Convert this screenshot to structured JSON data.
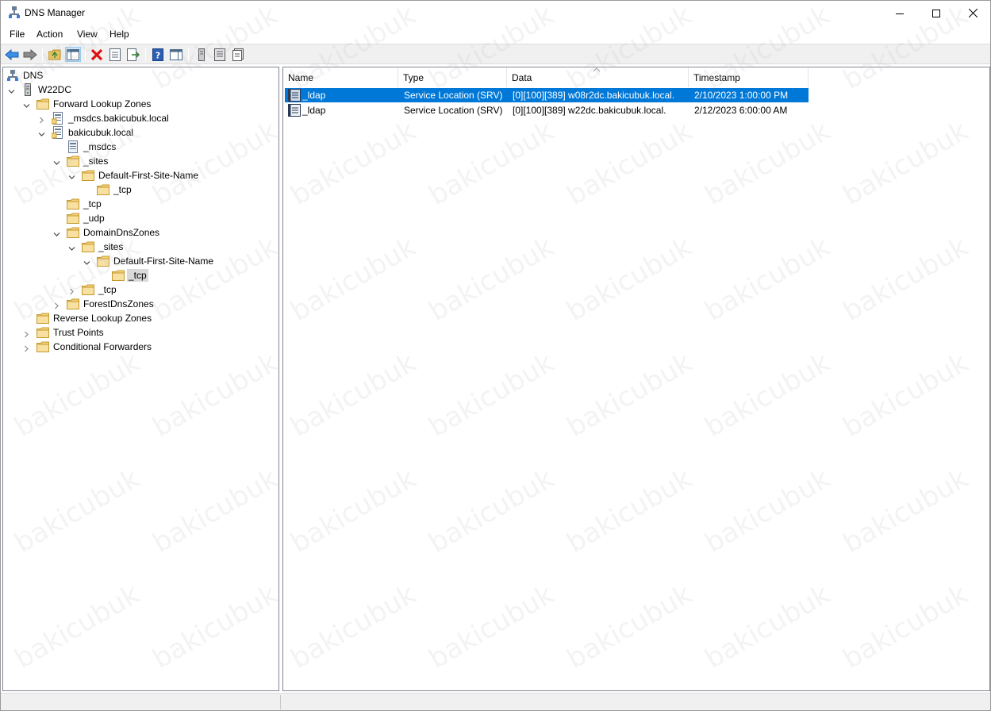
{
  "window": {
    "title": "DNS Manager",
    "controls": {
      "minimize": "minimize-icon",
      "maximize": "maximize-icon",
      "close": "close-icon"
    }
  },
  "menu": {
    "items": [
      "File",
      "Action",
      "View",
      "Help"
    ]
  },
  "toolbar": {
    "buttons": [
      "back-arrow-icon",
      "forward-arrow-icon",
      "up-folder-icon",
      "show-hide-console-tree-icon",
      "delete-icon",
      "properties-icon",
      "export-list-icon",
      "help-icon",
      "show-action-pane-icon",
      "new-host-icon",
      "new-alias-icon",
      "new-mail-exchanger-icon"
    ]
  },
  "tree": {
    "root": "DNS",
    "server": "W22DC",
    "forward_lookup_zones": "Forward Lookup Zones",
    "msdcs_zone": "_msdcs.bakicubuk.local",
    "domain_zone": "bakicubuk.local",
    "msdcs_delegation": "_msdcs",
    "sites": "_sites",
    "default_site": "Default-First-Site-Name",
    "site_tcp": "_tcp",
    "tcp": "_tcp",
    "udp": "_udp",
    "domain_dns_zones": "DomainDnsZones",
    "dd_sites": "_sites",
    "dd_default_site": "Default-First-Site-Name",
    "dd_site_tcp": "_tcp",
    "dd_tcp": "_tcp",
    "forest_dns_zones": "ForestDnsZones",
    "reverse_lookup_zones": "Reverse Lookup Zones",
    "trust_points": "Trust Points",
    "conditional_forwarders": "Conditional Forwarders"
  },
  "list": {
    "columns": [
      "Name",
      "Type",
      "Data",
      "Timestamp"
    ],
    "rows": [
      {
        "name": "_ldap",
        "type": "Service Location (SRV)",
        "data": "[0][100][389] w08r2dc.bakicubuk.local.",
        "timestamp": "2/10/2023 1:00:00 PM",
        "selected": true
      },
      {
        "name": "_ldap",
        "type": "Service Location (SRV)",
        "data": "[0][100][389] w22dc.bakicubuk.local.",
        "timestamp": "2/12/2023 6:00:00 AM",
        "selected": false
      }
    ]
  },
  "watermark": "bakicubuk",
  "colors": {
    "selection": "#0078d7",
    "tree_selection": "#d9d9d9",
    "folder": "#e8c15a",
    "toolbar_bg": "#f0f0f0"
  }
}
